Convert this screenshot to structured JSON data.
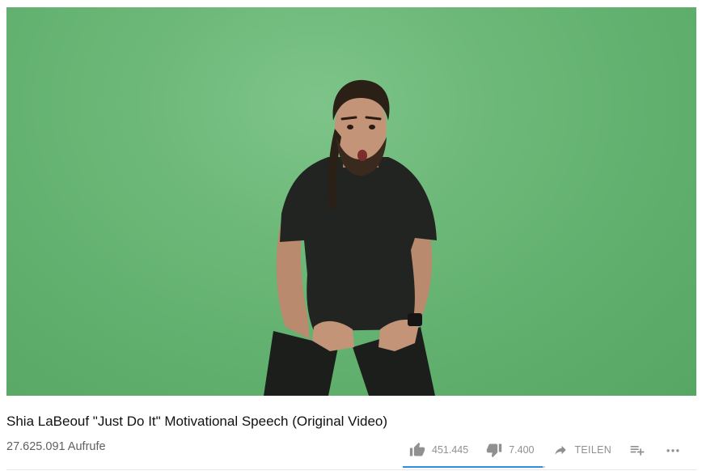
{
  "video": {
    "title": "Shia LaBeouf \"Just Do It\" Motivational Speech (Original Video)",
    "views": "27.625.091 Aufrufe"
  },
  "actions": {
    "likes": "451.445",
    "dislikes": "7.400",
    "share_label": "TEILEN",
    "like_ratio": 0.984
  },
  "icons": {
    "like": "thumb-up-icon",
    "dislike": "thumb-down-icon",
    "share": "share-arrow-icon",
    "add_to_playlist": "playlist-add-icon",
    "more": "more-horizontal-icon"
  },
  "colors": {
    "green_screen": "#6cb878",
    "sentiment_like": "#2f8fe0",
    "sentiment_bg": "#cccccc",
    "action_text": "#909090"
  }
}
